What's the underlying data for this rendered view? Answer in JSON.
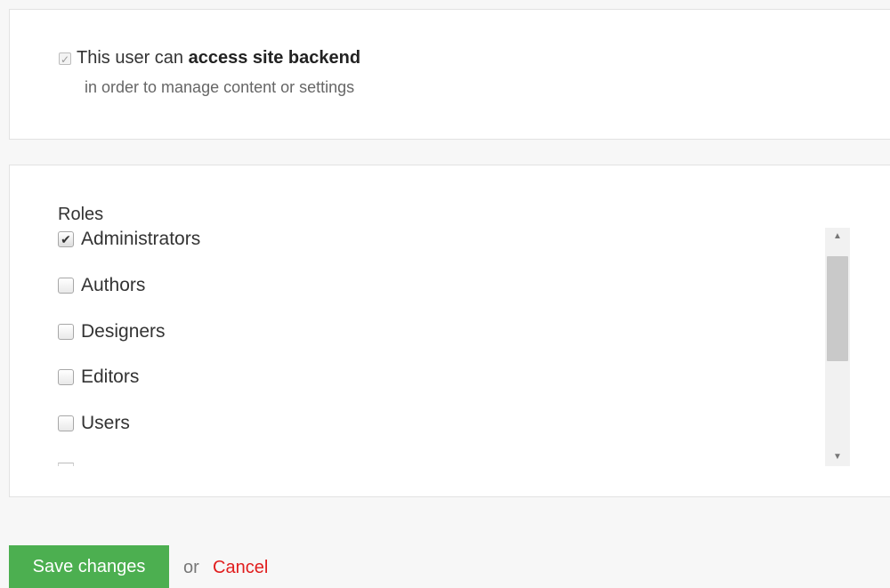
{
  "access": {
    "checked": true,
    "label_prefix": "This user can ",
    "label_bold": "access site backend",
    "help_text": "in order to manage content or settings"
  },
  "roles": {
    "title": "Roles",
    "items": [
      {
        "label": "Administrators",
        "checked": true
      },
      {
        "label": "Authors",
        "checked": false
      },
      {
        "label": "Designers",
        "checked": false
      },
      {
        "label": "Editors",
        "checked": false
      },
      {
        "label": "Users",
        "checked": false
      }
    ]
  },
  "scrollbar": {
    "up_icon": "triangle-up",
    "down_icon": "triangle-down",
    "thumb_state": "top"
  },
  "actions": {
    "save_label": "Save changes",
    "or_label": "or",
    "cancel_label": "Cancel",
    "save_color": "#4caf50",
    "cancel_color": "#e11d1d"
  }
}
